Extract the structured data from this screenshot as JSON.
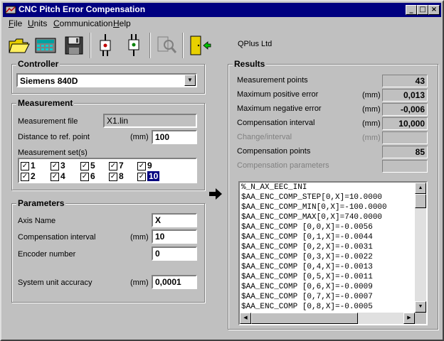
{
  "window": {
    "title": "CNC Pitch Error Compensation",
    "min": "_",
    "max": "□",
    "close": "×"
  },
  "menu": [
    {
      "label": "File",
      "accel": "F",
      "rest": "ile"
    },
    {
      "label": "Units",
      "accel": "U",
      "rest": "nits"
    },
    {
      "label": "Communication",
      "accel": "C",
      "rest": "ommunication"
    },
    {
      "label": "Help",
      "accel": "H",
      "rest": "elp"
    }
  ],
  "toolbar": {
    "icons": [
      "open-folder-icon",
      "calculator-icon",
      "save-disk-icon",
      "plug-send-icon",
      "plug-receive-icon",
      "inspect-icon",
      "exit-door-icon"
    ],
    "company": "QPlus Ltd"
  },
  "controller": {
    "title": "Controller",
    "selected": "Siemens 840D"
  },
  "measurement": {
    "title": "Measurement",
    "file_label": "Measurement file",
    "file_value": "X1.lin",
    "distance_label": "Distance to ref. point",
    "distance_unit": "(mm)",
    "distance_value": "100",
    "sets_label": "Measurement set(s)",
    "sets": [
      "1",
      "2",
      "3",
      "4",
      "5",
      "6",
      "7",
      "8",
      "9",
      "10"
    ],
    "sets_selected": "10"
  },
  "parameters": {
    "title": "Parameters",
    "axis_label": "Axis Name",
    "axis_value": "X",
    "interval_label": "Compensation interval",
    "interval_unit": "(mm)",
    "interval_value": "10",
    "encoder_label": "Encoder number",
    "encoder_value": "0",
    "accuracy_label": "System unit accuracy",
    "accuracy_unit": "(mm)",
    "accuracy_value": "0,0001"
  },
  "results": {
    "title": "Results",
    "rows": [
      {
        "label": "Measurement points",
        "unit": "",
        "value": "43",
        "disabled": false
      },
      {
        "label": "Maximum positive error",
        "unit": "(mm)",
        "value": "0,013",
        "disabled": false
      },
      {
        "label": "Maximum negative error",
        "unit": "(mm)",
        "value": "-0,006",
        "disabled": false
      },
      {
        "label": "Compensation interval",
        "unit": "(mm)",
        "value": "10,000",
        "disabled": false
      },
      {
        "label": "Change/interval",
        "unit": "(mm)",
        "value": "",
        "disabled": true
      },
      {
        "label": "Compensation points",
        "unit": "",
        "value": "85",
        "disabled": false
      },
      {
        "label": "Compensation parameters",
        "unit": "",
        "value": "",
        "disabled": true
      }
    ],
    "code_lines": [
      "%_N_AX_EEC_INI",
      "$AA_ENC_COMP_STEP[0,X]=10.0000",
      "$AA_ENC_COMP_MIN[0,X]=-100.0000",
      "$AA_ENC_COMP_MAX[0,X]=740.0000",
      "$AA_ENC_COMP [0,0,X]=-0.0056",
      "$AA_ENC_COMP [0,1,X]=-0.0044",
      "$AA_ENC_COMP [0,2,X]=-0.0031",
      "$AA_ENC_COMP [0,3,X]=-0.0022",
      "$AA_ENC_COMP [0,4,X]=-0.0013",
      "$AA_ENC_COMP [0,5,X]=-0.0011",
      "$AA_ENC_COMP [0,6,X]=-0.0009",
      "$AA_ENC_COMP [0,7,X]=-0.0007",
      "$AA_ENC_COMP [0,8,X]=-0.0005"
    ]
  },
  "colors": {
    "title_bar": "#000080",
    "face": "#c0c0c0",
    "selection": "#000080"
  }
}
